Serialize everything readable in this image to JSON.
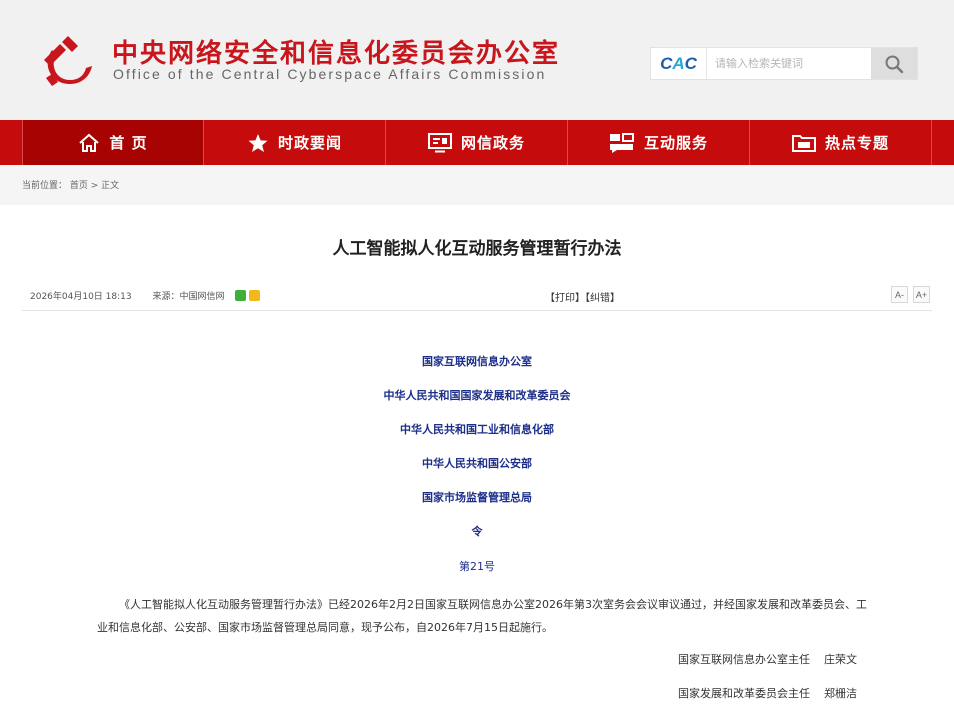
{
  "header": {
    "title_cn": "中央网络安全和信息化委员会办公室",
    "title_en": "Office of the Central Cyberspace Affairs Commission",
    "emblem_icon": "party-emblem-icon",
    "brand_color": "#c8161d"
  },
  "search": {
    "logo_text_1": "C",
    "logo_text_2": "A",
    "logo_text_3": "C",
    "placeholder": "请输入检索关键词",
    "button_icon": "search-icon"
  },
  "nav": {
    "items": [
      {
        "label": "首 页",
        "icon": "home-icon"
      },
      {
        "label": "时政要闻",
        "icon": "star-icon"
      },
      {
        "label": "网信政务",
        "icon": "monitor-icon"
      },
      {
        "label": "互动服务",
        "icon": "chat-icon"
      },
      {
        "label": "热点专题",
        "icon": "folder-icon"
      }
    ],
    "color": "#c50b0b"
  },
  "breadcrumb": {
    "prefix": "当前位置：",
    "home": "首页",
    "separator": " > ",
    "current": "正文"
  },
  "article": {
    "title": "人工智能拟人化互动服务管理暂行办法",
    "date": "2026年04月10日 18:13",
    "source_label": "来源：",
    "source": "中国网信网",
    "print": "【打印】",
    "correct": "【纠错】",
    "font_smaller": "A-",
    "font_larger": "A+",
    "issuers": [
      "国家互联网信息办公室",
      "中华人民共和国国家发展和改革委员会",
      "中华人民共和国工业和信息化部",
      "中华人民共和国公安部",
      "国家市场监督管理总局"
    ],
    "order_label": "令",
    "order_no": "第21号",
    "paragraph": "《人工智能拟人化互动服务管理暂行办法》已经2026年2月2日国家互联网信息办公室2026年第3次室务会会议审议通过，并经国家发展和改革委员会、工业和信息化部、公安部、国家市场监督管理总局同意，现予公布，自2026年7月15日起施行。",
    "signatures": [
      {
        "title": "国家互联网信息办公室主任",
        "name": "庄荣文"
      },
      {
        "title": "国家发展和改革委员会主任",
        "name": "郑栅洁"
      }
    ]
  }
}
